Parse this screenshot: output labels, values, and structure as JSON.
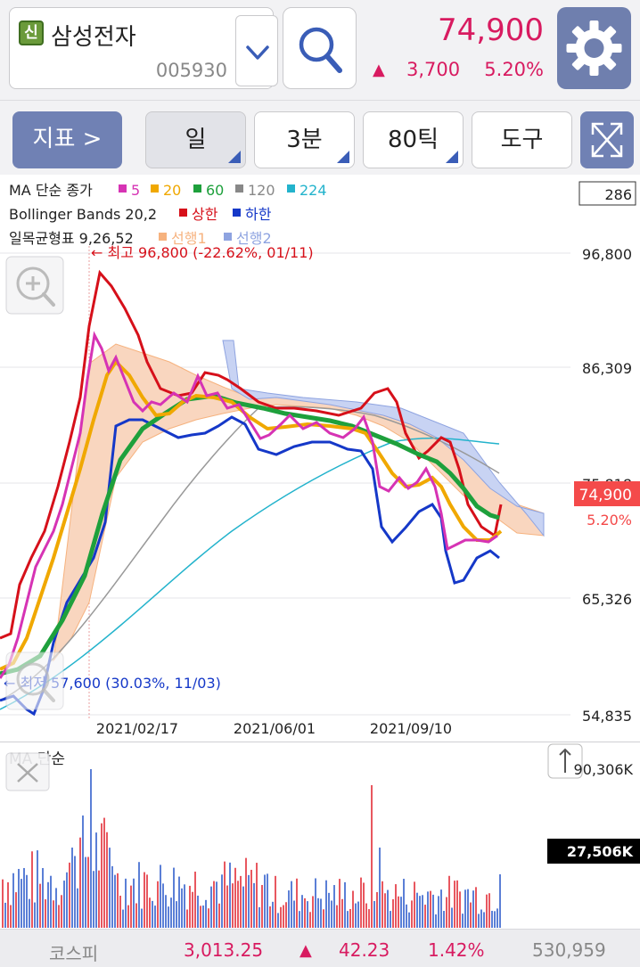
{
  "header": {
    "badge": "신",
    "stock_name": "삼성전자",
    "stock_code": "005930",
    "price": "74,900",
    "change_arrow": "▲",
    "change": "3,700",
    "change_pct": "5.20%"
  },
  "icons": {
    "dropdown": "chevron-down-icon",
    "search": "search-icon",
    "settings": "gear-icon",
    "expand": "expand-icon",
    "zoom": "zoom-in-icon",
    "close": "close-icon",
    "sort": "sort-arrows-icon"
  },
  "toolbar": {
    "indicator_label": "지표 >",
    "buttons": [
      "일",
      "3분",
      "80틱",
      "도구"
    ]
  },
  "chart": {
    "legend": {
      "ma_label": "MA 단순 종가",
      "ma_periods": [
        {
          "label": "5",
          "color": "#d633b4"
        },
        {
          "label": "20",
          "color": "#f0a800"
        },
        {
          "label": "60",
          "color": "#1ea03c"
        },
        {
          "label": "120",
          "color": "#888888"
        },
        {
          "label": "224",
          "color": "#23b3cc"
        }
      ],
      "bb_label": "Bollinger Bands 20,2",
      "bb_upper": "상한",
      "bb_lower": "하한",
      "ichimoku_label": "일목균형표 9,26,52",
      "ichimoku_span1": "선행1",
      "ichimoku_span2": "선행2"
    },
    "max_annotation": "← 최고 96,800 (-22.62%, 01/11)",
    "min_annotation": "← 최저 57,600 (30.03%, 11/03)",
    "top_right_box": "286",
    "y_ticks": [
      "96,800",
      "86,309",
      "75,818",
      "65,326",
      "54,835"
    ],
    "x_ticks": [
      "2021/02/17",
      "2021/06/01",
      "2021/09/10"
    ],
    "current_price_label": "74,900",
    "current_pct_label": "5.20%",
    "colors": {
      "up": "#d81b60",
      "bb_upper": "#d6101a",
      "bb_lower": "#1538c8",
      "span1": "#f6b27e",
      "span2": "#8ea3e0"
    }
  },
  "volume": {
    "label": "MA 단순",
    "max_label": "90,306K",
    "current_label": "27,506K"
  },
  "statusbar": {
    "index_name": "코스피",
    "index_value": "3,013.25",
    "arrow": "▲",
    "change": "42.23",
    "pct": "1.42%",
    "volume": "530,959"
  }
}
